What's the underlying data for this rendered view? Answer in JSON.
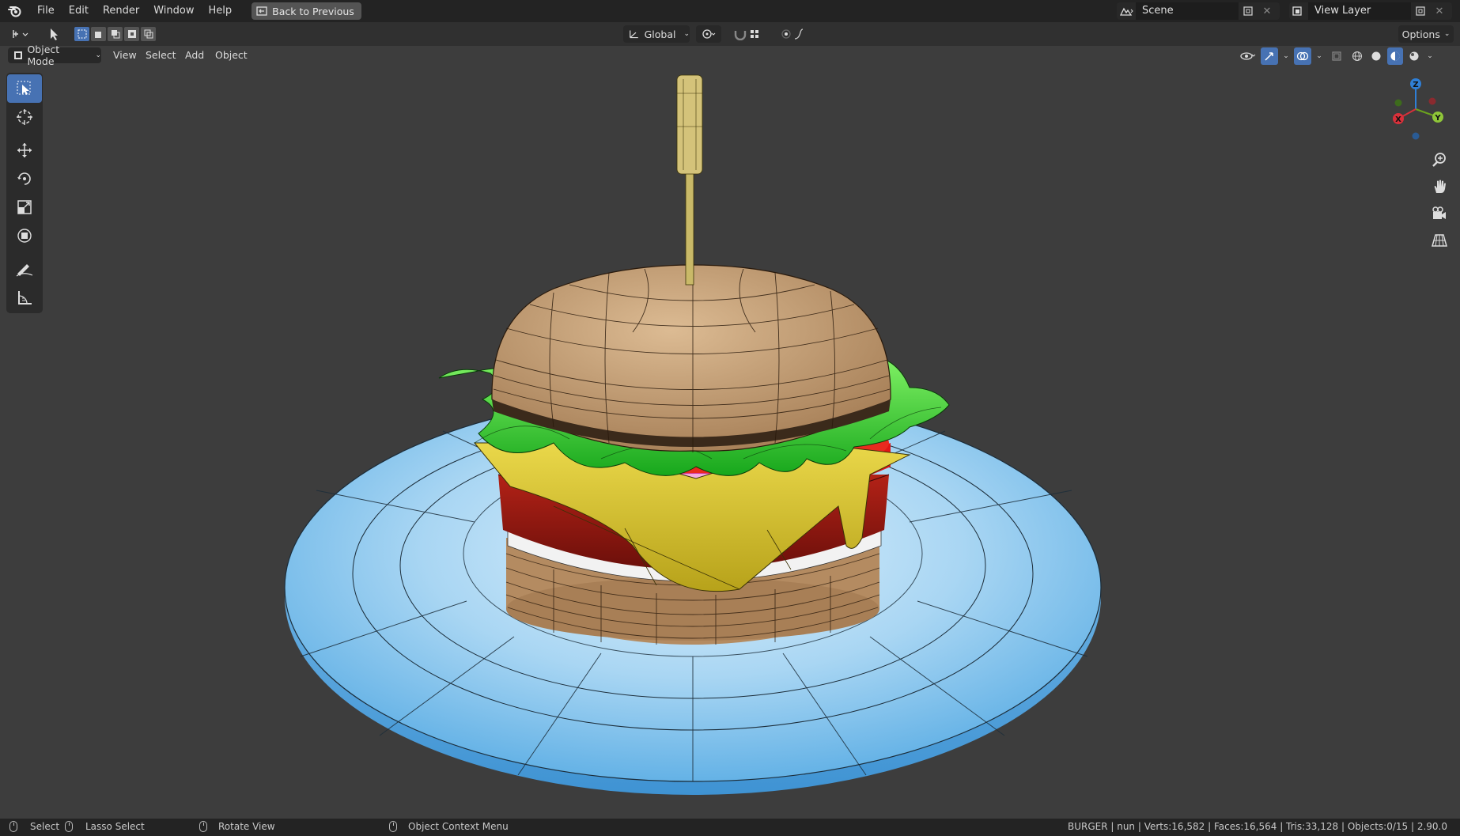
{
  "menubar": {
    "items": [
      "File",
      "Edit",
      "Render",
      "Window",
      "Help"
    ],
    "back_button": "Back to Previous",
    "scene": "Scene",
    "view_layer": "View Layer"
  },
  "header": {
    "transform_orientation": "Global",
    "options": "Options",
    "mode": "Object Mode",
    "menus": [
      "View",
      "Select",
      "Add",
      "Object"
    ]
  },
  "gizmo": {
    "x": "X",
    "y": "Y",
    "z": "Z"
  },
  "statusbar": {
    "select": "Select",
    "lasso": "Lasso Select",
    "rotate": "Rotate View",
    "context": "Object Context Menu",
    "stats": "BURGER | nun | Verts:16,582 | Faces:16,564 | Tris:33,128 | Objects:0/15 | 2.90.0"
  },
  "colors": {
    "accent": "#4772b3",
    "viewport_bg": "#3d3d3d",
    "plate": "#78bce8",
    "bun": "#c9a479",
    "lettuce": "#35d22e",
    "cheese": "#d6c227",
    "patty": "#9b1a12",
    "tomato": "#e01616"
  }
}
